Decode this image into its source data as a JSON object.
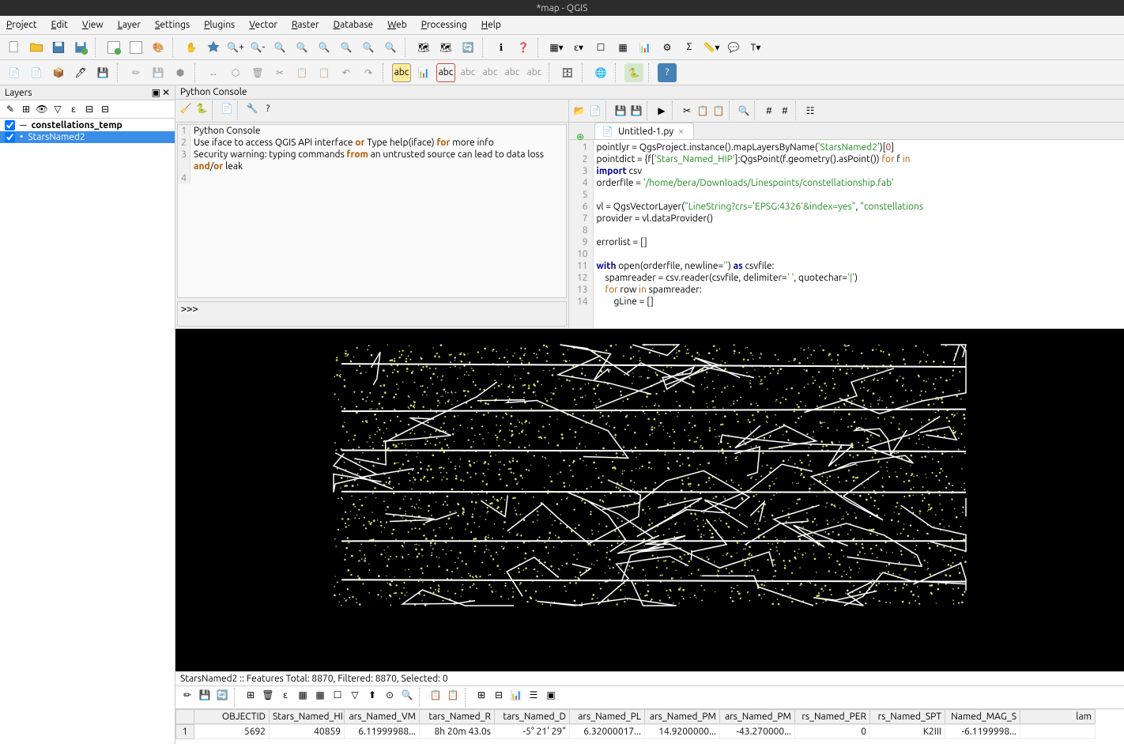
{
  "window": {
    "title": "*map - QGIS"
  },
  "menu": [
    "Project",
    "Edit",
    "View",
    "Layer",
    "Settings",
    "Plugins",
    "Vector",
    "Raster",
    "Database",
    "Web",
    "Processing",
    "Help"
  ],
  "panels": {
    "layers_title": "Layers",
    "python_title": "Python Console"
  },
  "layers": [
    {
      "name": "constellations_temp",
      "checked": true,
      "selected": false,
      "icon": "line"
    },
    {
      "name": "StarsNamed2",
      "checked": true,
      "selected": true,
      "icon": "point"
    }
  ],
  "console": {
    "lines": [
      {
        "n": "1",
        "text": "Python Console"
      },
      {
        "n": "2",
        "text": "Use iface to access QGIS API interface <b class='kw-orange'>or</b> Type help(iface) <b class='kw-orange'>for</b> more info"
      },
      {
        "n": "3",
        "text": "Security warning: typing commands <b class='kw-orange'>from</b> an untrusted source can lead to data loss <b class='kw-orange'>and</b>/<b class='kw-orange'>or</b> leak"
      },
      {
        "n": "4",
        "text": ""
      }
    ],
    "prompt": ">>>"
  },
  "editor": {
    "tab_name": "Untitled-1.py",
    "code_lines": [
      "pointlyr = QgsProject.instance().mapLayersByName(<span class='kw-green'>'StarsNamed2'</span>)[<span class='kw-red'>0</span>]",
      "pointdict = {f[<span class='kw-green'>'Stars_Named_HIP'</span>]:QgsPoint(f.geometry().asPoint()) <span class='kw-orange'>for</span> f <span class='kw-orange'>in</span>",
      "<span class='kw-blue'>import</span> csv",
      "orderfile = <span class='kw-green'>'/home/bera/Downloads/Linespoints/constellationship.fab'</span>",
      "",
      "vl = QgsVectorLayer(<span class='kw-green'>\"LineString?crs='EPSG:4326'&index=yes\"</span>, <span class='kw-green'>\"constellations</span>",
      "provider = vl.dataProvider()",
      "",
      "errorlist = []",
      "",
      "<span class='kw-blue'>with</span> open(orderfile, newline=<span class='kw-green'>''</span>) <span class='kw-blue'>as</span> csvfile:",
      "    spamreader = csv.reader(csvfile, delimiter=<span class='kw-green'>' '</span>, quotechar=<span class='kw-green'>'|'</span>)",
      "    <span class='kw-orange'>for</span> row <span class='kw-orange'>in</span> spamreader:",
      "        gLine = []"
    ]
  },
  "attribute_table": {
    "status": "StarsNamed2 :: Features Total: 8870, Filtered: 8870, Selected: 0",
    "columns": [
      "OBJECTID",
      "Stars_Named_HIP",
      "ars_Named_VM",
      "tars_Named_R",
      "tars_Named_D",
      "ars_Named_PL",
      "ars_Named_PM",
      "ars_Named_PM",
      "rs_Named_PER",
      "rs_Named_SPT",
      "Named_MAG_S",
      "lam"
    ],
    "rows": [
      {
        "n": "1",
        "cells": [
          "5692",
          "40859",
          "6.11999988...",
          "8h 20m 43.0s",
          "-5° 21' 29\"",
          "6.32000017...",
          "14.9200000...",
          "-43.270000...",
          "0",
          "K2III",
          "-6.1199998...",
          ""
        ]
      }
    ]
  }
}
